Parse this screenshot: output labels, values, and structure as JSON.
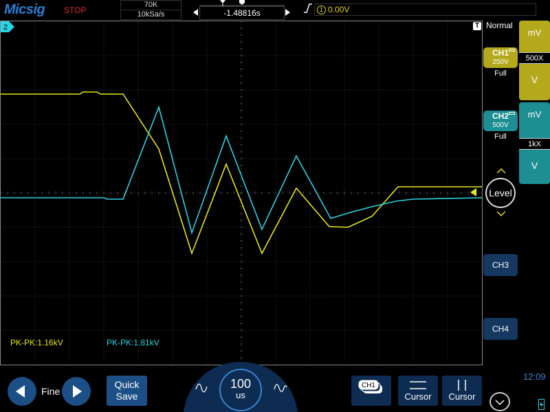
{
  "header": {
    "brand": "Micsig",
    "run_state": "STOP",
    "memory_depth": "70K",
    "sample_rate": "10kSa/s",
    "time_offset": "-1.48816s",
    "trigger_source": "1",
    "trigger_level": "0.00V"
  },
  "screen": {
    "measurements": [
      {
        "label": "PK-PK:1.16kV",
        "color": "#e8e81a"
      },
      {
        "label": "PK-PK:1.81kV",
        "color": "#2ad4e4"
      }
    ],
    "ch2_marker": "2",
    "trigger_marker": "T"
  },
  "right_panel": {
    "acquisition_mode": "Normal",
    "ch1": {
      "name": "CH1",
      "scale": "250V",
      "coupling": "Full",
      "color": "#b4a91c"
    },
    "ch2": {
      "name": "CH2",
      "scale": "500V",
      "coupling": "Full",
      "color": "#1d8e92"
    },
    "ch1_knob": {
      "unit": "mV",
      "ratio": "500X",
      "down_unit": "V"
    },
    "ch2_knob": {
      "unit": "mV",
      "ratio": "1kX",
      "down_unit": "V"
    },
    "level_label": "Level",
    "ch3_label": "CH3",
    "ch4_label": "CH4"
  },
  "bottom_bar": {
    "fine_label": "Fine",
    "quick_save_line1": "Quick",
    "quick_save_line2": "Save",
    "time_div_value": "100",
    "time_div_unit": "us",
    "channel_select": "CH1",
    "cursor_h_label": "Cursor",
    "cursor_v_label": "Cursor",
    "clock": "12:09"
  },
  "colors": {
    "ch1": "#e8e81a",
    "ch2": "#2ad4e4",
    "accent": "#1c4f86",
    "brand": "#2a7fd6",
    "stop": "#e03030"
  }
}
